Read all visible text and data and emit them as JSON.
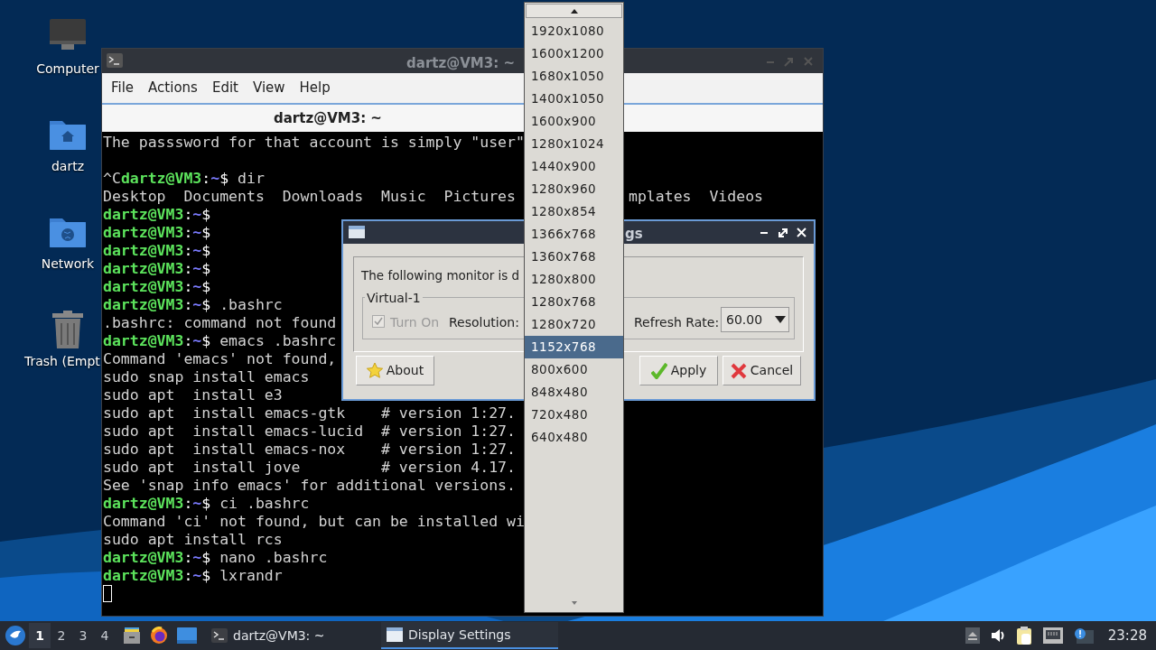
{
  "desktop_icons": [
    {
      "kind": "computer",
      "label": "Computer"
    },
    {
      "kind": "home",
      "label": "dartz"
    },
    {
      "kind": "network",
      "label": "Network"
    },
    {
      "kind": "trash",
      "label": "Trash (Empt"
    }
  ],
  "terminal": {
    "title": "dartz@VM3: ~",
    "menu": [
      "File",
      "Actions",
      "Edit",
      "View",
      "Help"
    ],
    "tab": "dartz@VM3: ~",
    "lines": [
      {
        "kind": "output",
        "text": "The passsword for that account is simply \"user\""
      },
      {
        "kind": "blank"
      },
      {
        "kind": "prompt",
        "prefix": "^C",
        "user": "dartz@VM3",
        "colon": ":",
        "path": "~",
        "sign": "$",
        "command": " dir"
      },
      {
        "kind": "output",
        "text": "Desktop  Documents  Downloads  Music  Pictures",
        "tail": "mplates  Videos"
      },
      {
        "kind": "prompt",
        "user": "dartz@VM3",
        "colon": ":",
        "path": "~",
        "sign": "$"
      },
      {
        "kind": "prompt",
        "user": "dartz@VM3",
        "colon": ":",
        "path": "~",
        "sign": "$"
      },
      {
        "kind": "prompt",
        "user": "dartz@VM3",
        "colon": ":",
        "path": "~",
        "sign": "$"
      },
      {
        "kind": "prompt",
        "user": "dartz@VM3",
        "colon": ":",
        "path": "~",
        "sign": "$"
      },
      {
        "kind": "prompt",
        "user": "dartz@VM3",
        "colon": ":",
        "path": "~",
        "sign": "$"
      },
      {
        "kind": "prompt",
        "user": "dartz@VM3",
        "colon": ":",
        "path": "~",
        "sign": "$",
        "command": " .bashrc"
      },
      {
        "kind": "output",
        "text": ".bashrc: command not found"
      },
      {
        "kind": "prompt",
        "user": "dartz@VM3",
        "colon": ":",
        "path": "~",
        "sign": "$",
        "command": " emacs .bashrc"
      },
      {
        "kind": "output",
        "text": "Command 'emacs' not found,"
      },
      {
        "kind": "output",
        "text": "sudo snap install emacs"
      },
      {
        "kind": "output",
        "text": "sudo apt  install e3"
      },
      {
        "kind": "output",
        "text": "sudo apt  install emacs-gtk    # version 1:27."
      },
      {
        "kind": "output",
        "text": "sudo apt  install emacs-lucid  # version 1:27."
      },
      {
        "kind": "output",
        "text": "sudo apt  install emacs-nox    # version 1:27."
      },
      {
        "kind": "output",
        "text": "sudo apt  install jove         # version 4.17."
      },
      {
        "kind": "output",
        "text": "See 'snap info emacs' for additional versions."
      },
      {
        "kind": "prompt",
        "user": "dartz@VM3",
        "colon": ":",
        "path": "~",
        "sign": "$",
        "command": " ci .bashrc"
      },
      {
        "kind": "output",
        "text": "Command 'ci' not found, but can be installed wi"
      },
      {
        "kind": "output",
        "text": "sudo apt install rcs"
      },
      {
        "kind": "prompt",
        "user": "dartz@VM3",
        "colon": ":",
        "path": "~",
        "sign": "$",
        "command": " nano .bashrc"
      },
      {
        "kind": "prompt",
        "user": "dartz@VM3",
        "colon": ":",
        "path": "~",
        "sign": "$",
        "command": " lxrandr"
      },
      {
        "kind": "cursor"
      }
    ]
  },
  "dialog": {
    "title_right": "gs",
    "message": "The following monitor is d",
    "group": "Virtual-1",
    "turn_on": {
      "label": "Turn On",
      "checked": true,
      "disabled": true
    },
    "resolution_label": "Resolution:",
    "refresh_label": "Refresh Rate:",
    "refresh_value": "60.00",
    "buttons": [
      {
        "kind": "about",
        "label": "About"
      },
      {
        "kind": "apply",
        "label": "Apply"
      },
      {
        "kind": "cancel",
        "label": "Cancel"
      }
    ]
  },
  "dropdown": {
    "items": [
      {
        "label": "1920x1080",
        "selected": false
      },
      {
        "label": "1600x1200",
        "selected": false
      },
      {
        "label": "1680x1050",
        "selected": false
      },
      {
        "label": "1400x1050",
        "selected": false
      },
      {
        "label": "1600x900",
        "selected": false
      },
      {
        "label": "1280x1024",
        "selected": false
      },
      {
        "label": "1440x900",
        "selected": false
      },
      {
        "label": "1280x960",
        "selected": false
      },
      {
        "label": "1280x854",
        "selected": false
      },
      {
        "label": "1366x768",
        "selected": false
      },
      {
        "label": "1360x768",
        "selected": false
      },
      {
        "label": "1280x800",
        "selected": false
      },
      {
        "label": "1280x768",
        "selected": false
      },
      {
        "label": "1280x720",
        "selected": false
      },
      {
        "label": "1152x768",
        "selected": true
      },
      {
        "label": "800x600",
        "selected": false
      },
      {
        "label": "848x480",
        "selected": false
      },
      {
        "label": "720x480",
        "selected": false
      },
      {
        "label": "640x480",
        "selected": false
      }
    ]
  },
  "taskbar": {
    "workspaces": [
      {
        "label": "1",
        "selected": true
      },
      {
        "label": "2",
        "selected": false
      },
      {
        "label": "3",
        "selected": false
      },
      {
        "label": "4",
        "selected": false
      }
    ],
    "tasks": [
      {
        "kind": "terminal",
        "label": "dartz@VM3: ~",
        "selected": false
      },
      {
        "kind": "window",
        "label": "Display Settings",
        "selected": true
      }
    ],
    "clock": "23:28"
  }
}
